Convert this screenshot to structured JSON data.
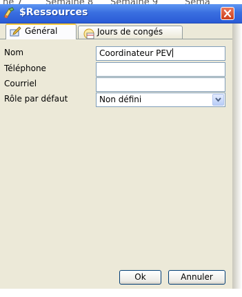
{
  "background": {
    "headers": [
      "ne 7",
      "Semaine 8",
      "Semaine 9",
      "Sema"
    ]
  },
  "window": {
    "title": "$Ressources",
    "icon": "app-icon",
    "close_icon": "close-icon"
  },
  "tabs": [
    {
      "label": "Général",
      "icon": "edit-icon",
      "active": true
    },
    {
      "label": "Jours de congés",
      "icon": "calendar-icon",
      "active": false
    }
  ],
  "form": {
    "fields": [
      {
        "label": "Nom",
        "value": "Coordinateur PEV"
      },
      {
        "label": "Téléphone",
        "value": ""
      },
      {
        "label": "Courriel",
        "value": ""
      }
    ],
    "role": {
      "label": "Rôle par défaut",
      "value": "Non défini"
    }
  },
  "buttons": {
    "ok": "Ok",
    "cancel": "Annuler"
  },
  "colors": {
    "titlebar": "#2a5bd6",
    "client_bg": "#ece9d8",
    "close_button": "#cd3f1b",
    "tab_highlight": "#ffc83c"
  }
}
